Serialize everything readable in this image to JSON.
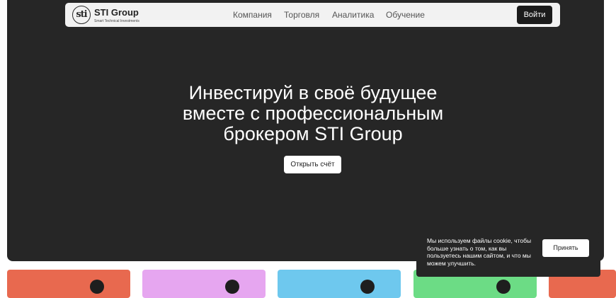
{
  "header": {
    "logo": {
      "mark": "sti",
      "name": "STI Group",
      "tagline": "Smart Technical Investments"
    },
    "nav": [
      {
        "label": "Компания"
      },
      {
        "label": "Торговля"
      },
      {
        "label": "Аналитика"
      },
      {
        "label": "Обучение"
      }
    ],
    "login_label": "Войти"
  },
  "hero": {
    "title_lines": [
      "Инвестируй в своё будущее",
      "вместе с профессиональным",
      "брокером STI Group"
    ],
    "cta_label": "Открыть счёт"
  },
  "cards": [
    {
      "color": "#e8694f"
    },
    {
      "color": "#e6a6f0"
    },
    {
      "color": "#6ec8ee"
    },
    {
      "color": "#6cdc85"
    },
    {
      "color": "#e8694f"
    }
  ],
  "cookie_banner": {
    "text": "Мы используем файлы cookie, чтобы больше узнать о том, как вы пользуетесь нашим сайтом, и что мы можем улучшить.",
    "accept_label": "Принять"
  },
  "colors": {
    "hero_background": "#262626",
    "navbar_background": "#f2f2f2",
    "button_dark": "#1b1b1b"
  }
}
